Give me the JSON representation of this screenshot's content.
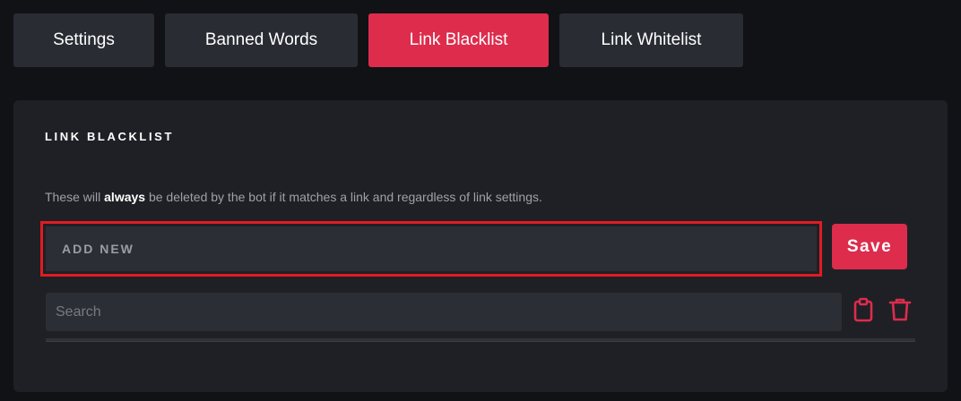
{
  "tabs": [
    {
      "label": "Settings",
      "active": false
    },
    {
      "label": "Banned Words",
      "active": false
    },
    {
      "label": "Link Blacklist",
      "active": true
    },
    {
      "label": "Link Whitelist",
      "active": false
    }
  ],
  "panel": {
    "title": "LINK BLACKLIST",
    "description": {
      "before": "These will ",
      "emphasis": "always",
      "after": " be deleted by the bot if it matches a link and regardless of link settings."
    },
    "add_new": {
      "placeholder": "ADD NEW",
      "value": ""
    },
    "save_label": "Save",
    "search": {
      "placeholder": "Search",
      "value": ""
    },
    "icons": {
      "paste": "clipboard-icon",
      "delete": "trash-icon"
    }
  },
  "colors": {
    "accent": "#dd2c4c",
    "highlight_border": "#e11b22",
    "background": "#111215",
    "panel": "#1f2025",
    "input": "#2b2e34",
    "tab": "#292c33"
  }
}
